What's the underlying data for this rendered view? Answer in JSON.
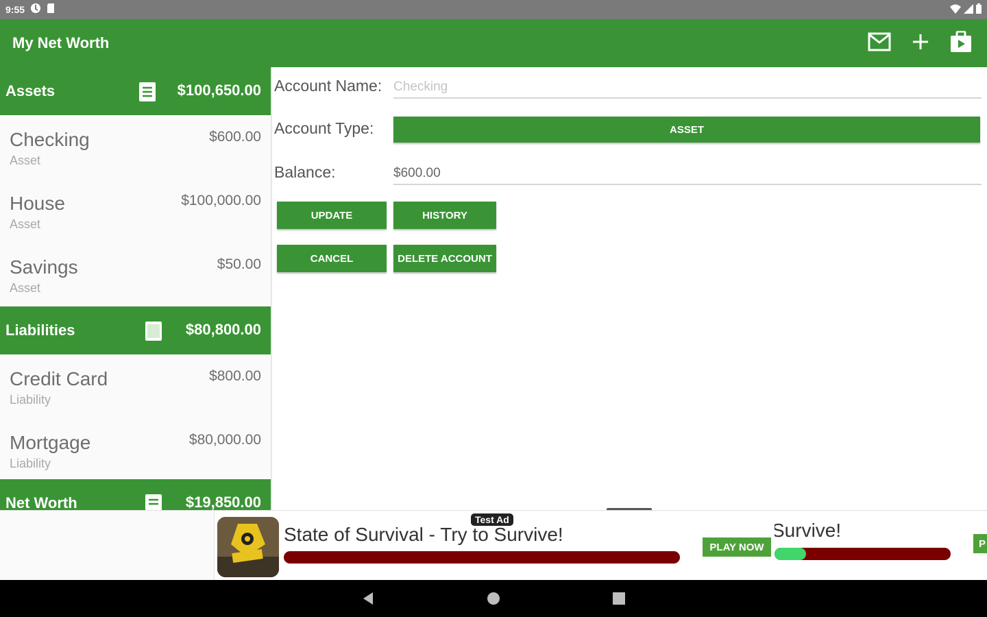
{
  "status_bar": {
    "time": "9:55"
  },
  "app_bar": {
    "title": "My Net Worth",
    "icons": [
      "mail-icon",
      "add-icon",
      "export-icon"
    ]
  },
  "assets": {
    "label": "Assets",
    "total": "$100,650.00",
    "accounts": [
      {
        "name": "Checking",
        "type": "Asset",
        "balance": "$600.00"
      },
      {
        "name": "House",
        "type": "Asset",
        "balance": "$100,000.00"
      },
      {
        "name": "Savings",
        "type": "Asset",
        "balance": "$50.00"
      }
    ]
  },
  "liabilities": {
    "label": "Liabilities",
    "total": "$80,800.00",
    "accounts": [
      {
        "name": "Credit Card",
        "type": "Liability",
        "balance": "$800.00"
      },
      {
        "name": "Mortgage",
        "type": "Liability",
        "balance": "$80,000.00"
      }
    ]
  },
  "net_worth": {
    "label": "Net Worth",
    "total": "$19,850.00"
  },
  "form": {
    "account_name_label": "Account Name:",
    "account_name_placeholder": "Checking",
    "account_type_label": "Account Type:",
    "account_type_value": "ASSET",
    "balance_label": "Balance:",
    "balance_value": "$600.00",
    "update_label": "UPDATE",
    "history_label": "HISTORY",
    "cancel_label": "CANCEL",
    "delete_label": "DELETE ACCOUNT"
  },
  "ad": {
    "tag": "Test Ad",
    "title": "State of Survival - Try to Survive!",
    "play_label": "PLAY NOW",
    "next_title": "Survive!",
    "next_play_label": "P"
  },
  "colors": {
    "primary_green": "#3a9435",
    "ad_bar_red": "#7a0000",
    "ad_progress_green": "#41d66a"
  }
}
